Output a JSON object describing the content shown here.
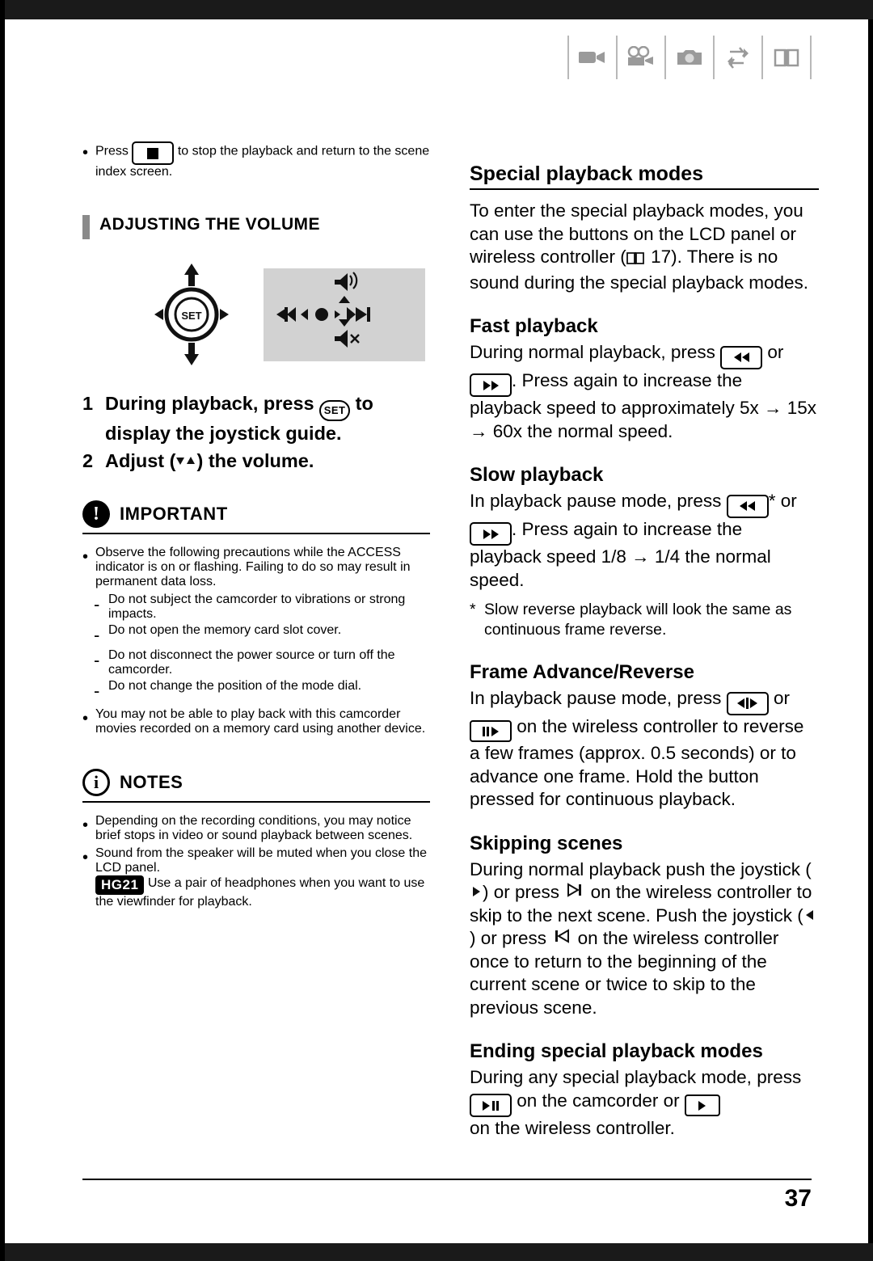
{
  "header": {
    "icons": [
      "video-camera-icon",
      "movie-camera-icon",
      "photo-camera-icon",
      "transfer-arrows-icon",
      "book-icon"
    ]
  },
  "left_column": {
    "intro_bullet": "Press        to stop the playback and return to the scene index screen.",
    "intro_bullet_part1": "Press",
    "intro_bullet_part2": "to stop the playback and return to the scene index screen.",
    "section_heading": "ADJUSTING THE VOLUME",
    "steps": [
      {
        "num": "1",
        "text_before": "During playback, press",
        "text_after": "to display the joystick guide."
      },
      {
        "num": "2",
        "text": "Adjust (     ) the volume."
      }
    ],
    "important": {
      "title": "IMPORTANT",
      "icon": "exclamation-icon",
      "bullets": [
        "Observe the following precautions while the ACCESS indicator is on or flashing. Failing to do so may result in permanent data loss.",
        "You may not be able to play back with this camcorder movies recorded on a memory card using another device."
      ],
      "dashes": [
        "Do not subject the camcorder to vibrations or strong impacts.",
        "Do not open the memory card slot cover.",
        "Do not disconnect the power source or turn off the camcorder.",
        "Do not change the position of the mode dial."
      ]
    },
    "notes": {
      "title": "NOTES",
      "icon": "information-icon",
      "bullets": [
        "Depending on the recording conditions, you may notice brief stops in video or sound playback between scenes.",
        "Sound from the speaker will be muted when you close the LCD panel."
      ],
      "hg21_badge": "HG21",
      "hg21_text": "Use a pair of headphones when you want to use the viewfinder for playback."
    }
  },
  "right_column": {
    "main_heading": "Special playback modes",
    "intro_part1": "To enter the special playback modes, you can use the buttons on the LCD panel or wireless controller (",
    "intro_page_ref": "17",
    "intro_part2": "). There is no sound during the special playback modes.",
    "fast_playback": {
      "heading": "Fast playback",
      "text_part1": "During normal playback, press",
      "text_part2": "or",
      "text_part3": ". Press again to increase the playback speed to approximately 5x",
      "text_part4": "15x",
      "text_part5": "60x the normal speed."
    },
    "slow_playback": {
      "heading": "Slow playback",
      "text_part1": "In playback pause mode, press",
      "text_part2": "* or",
      "text_part3": ". Press again to increase the playback speed 1/8",
      "text_part4": "1/4 the normal speed.",
      "footnote": "Slow reverse playback will look the same as continuous frame reverse."
    },
    "frame_advance": {
      "heading": "Frame Advance/Reverse",
      "text_part1": "In playback pause mode, press",
      "text_part2": "or",
      "text_part3": "on the wireless controller to reverse a few frames (approx. 0.5 seconds) or to advance one frame. Hold the button pressed for continuous playback."
    },
    "skipping_scenes": {
      "heading": "Skipping scenes",
      "text_part1": "During normal playback push the joystick (",
      "text_part2": ") or press",
      "text_part3": "on the wireless controller to skip to the next scene. Push the joystick (",
      "text_part4": ") or press",
      "text_part5": "on the wireless controller once to return to the beginning of the current scene or twice to skip to the previous scene."
    },
    "ending": {
      "heading": "Ending special playback modes",
      "text_part1": "During any special playback mode, press",
      "text_part2": "on the camcorder or",
      "text_part3": "on the wireless controller."
    }
  },
  "footer": {
    "page_number": "37"
  }
}
